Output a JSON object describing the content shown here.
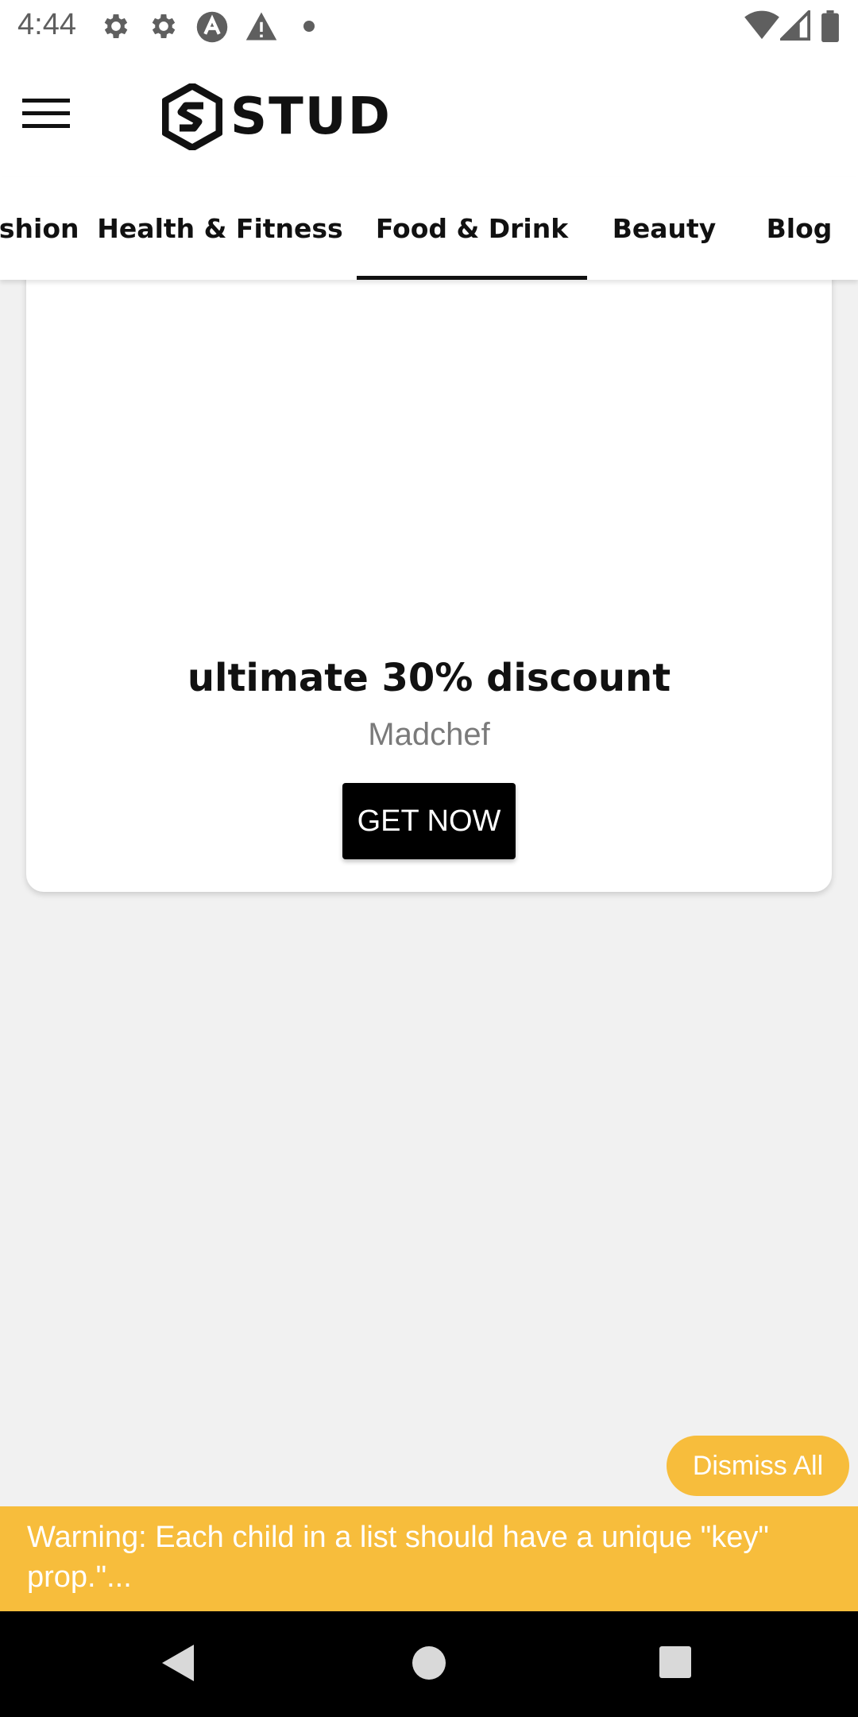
{
  "status_bar": {
    "time": "4:44",
    "left_icons": [
      "gear-icon",
      "gear-icon",
      "app-a-icon",
      "warning-icon",
      "dot-icon"
    ],
    "right_icons": [
      "wifi-icon",
      "signal-icon",
      "battery-icon"
    ]
  },
  "header": {
    "brand": "STUD",
    "menu_icon": "hamburger-icon"
  },
  "tabs": [
    {
      "label": "Fashion",
      "active": false
    },
    {
      "label": "Health & Fitness",
      "active": false
    },
    {
      "label": "Food & Drink",
      "active": true
    },
    {
      "label": "Beauty",
      "active": false
    },
    {
      "label": "Blog",
      "active": false
    }
  ],
  "card": {
    "title": "ultimate 30% discount",
    "subtitle": "Madchef",
    "button_label": "GET NOW"
  },
  "toast": {
    "dismiss_label": "Dismiss All",
    "warning_text": "Warning: Each child in a list should have a unique \"key\" prop.\"..."
  },
  "nav_bar": {
    "buttons": [
      "back-icon",
      "home-icon",
      "recents-icon"
    ]
  },
  "colors": {
    "warning": "#f7bd3c",
    "accent": "#000000",
    "background": "#f1f1f1"
  }
}
